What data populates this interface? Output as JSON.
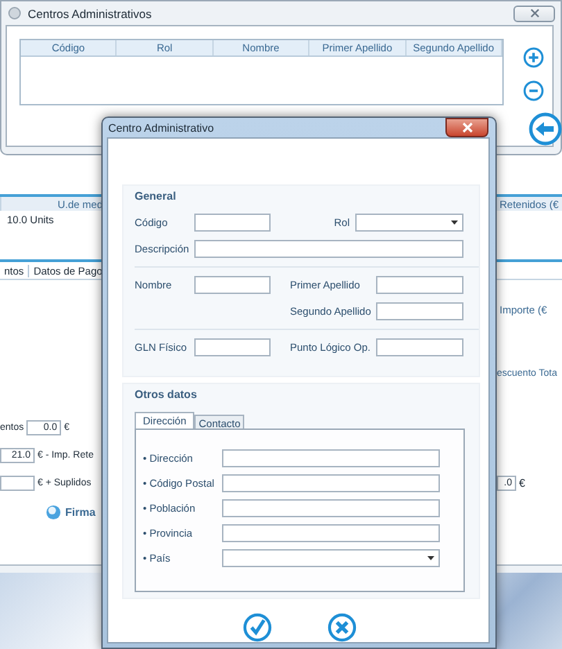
{
  "main_window": {
    "title": "Centros Administrativos",
    "table": {
      "columns": [
        "Código",
        "Rol",
        "Nombre",
        "Primer Apellido",
        "Segundo Apellido"
      ]
    }
  },
  "background_app": {
    "grid_header": {
      "column_1": "U.de med",
      "column_2": "Retenidos (€"
    },
    "grid_row": {
      "cell_1": "10.0 Units"
    },
    "tabs": [
      "ntos",
      "Datos de Pago"
    ],
    "column_right": "Importe (€",
    "discount_label": "escuento Tota",
    "totals": [
      {
        "label": "entos",
        "value": "0.0",
        "unit": "€"
      },
      {
        "value": "21.0",
        "unit": "€ - Imp. Rete"
      },
      {
        "unit": "€ + Suplidos",
        "right_value": ".0",
        "right_unit": "€"
      }
    ],
    "sign_button": "Firma"
  },
  "dialog": {
    "title": "Centro Administrativo",
    "general": {
      "label": "General",
      "groups": [
        [
          {
            "left": {
              "label": "Código",
              "kind": "text"
            },
            "right": {
              "label": "Rol",
              "kind": "select"
            }
          },
          {
            "left": {
              "label": "Descripción",
              "kind": "wide"
            }
          }
        ],
        [
          {
            "left": {
              "label": "Nombre",
              "kind": "text"
            },
            "right": {
              "label": "Primer Apellido",
              "kind": "text"
            }
          },
          {
            "right": {
              "label": "Segundo Apellido",
              "kind": "text"
            }
          }
        ],
        [
          {
            "left": {
              "label": "GLN Físico",
              "kind": "text"
            },
            "right": {
              "label": "Punto Lógico Op.",
              "kind": "text"
            }
          }
        ]
      ]
    },
    "other": {
      "label": "Otros datos",
      "tabs": [
        {
          "label": "Dirección",
          "selected": true
        },
        {
          "label": "Contacto",
          "selected": false
        }
      ],
      "fields": [
        {
          "label": "• Dirección",
          "kind": "text"
        },
        {
          "label": "• Código Postal",
          "kind": "text"
        },
        {
          "label": "• Población",
          "kind": "text"
        },
        {
          "label": "• Provincia",
          "kind": "text"
        },
        {
          "label": "• País",
          "kind": "select"
        }
      ]
    }
  }
}
